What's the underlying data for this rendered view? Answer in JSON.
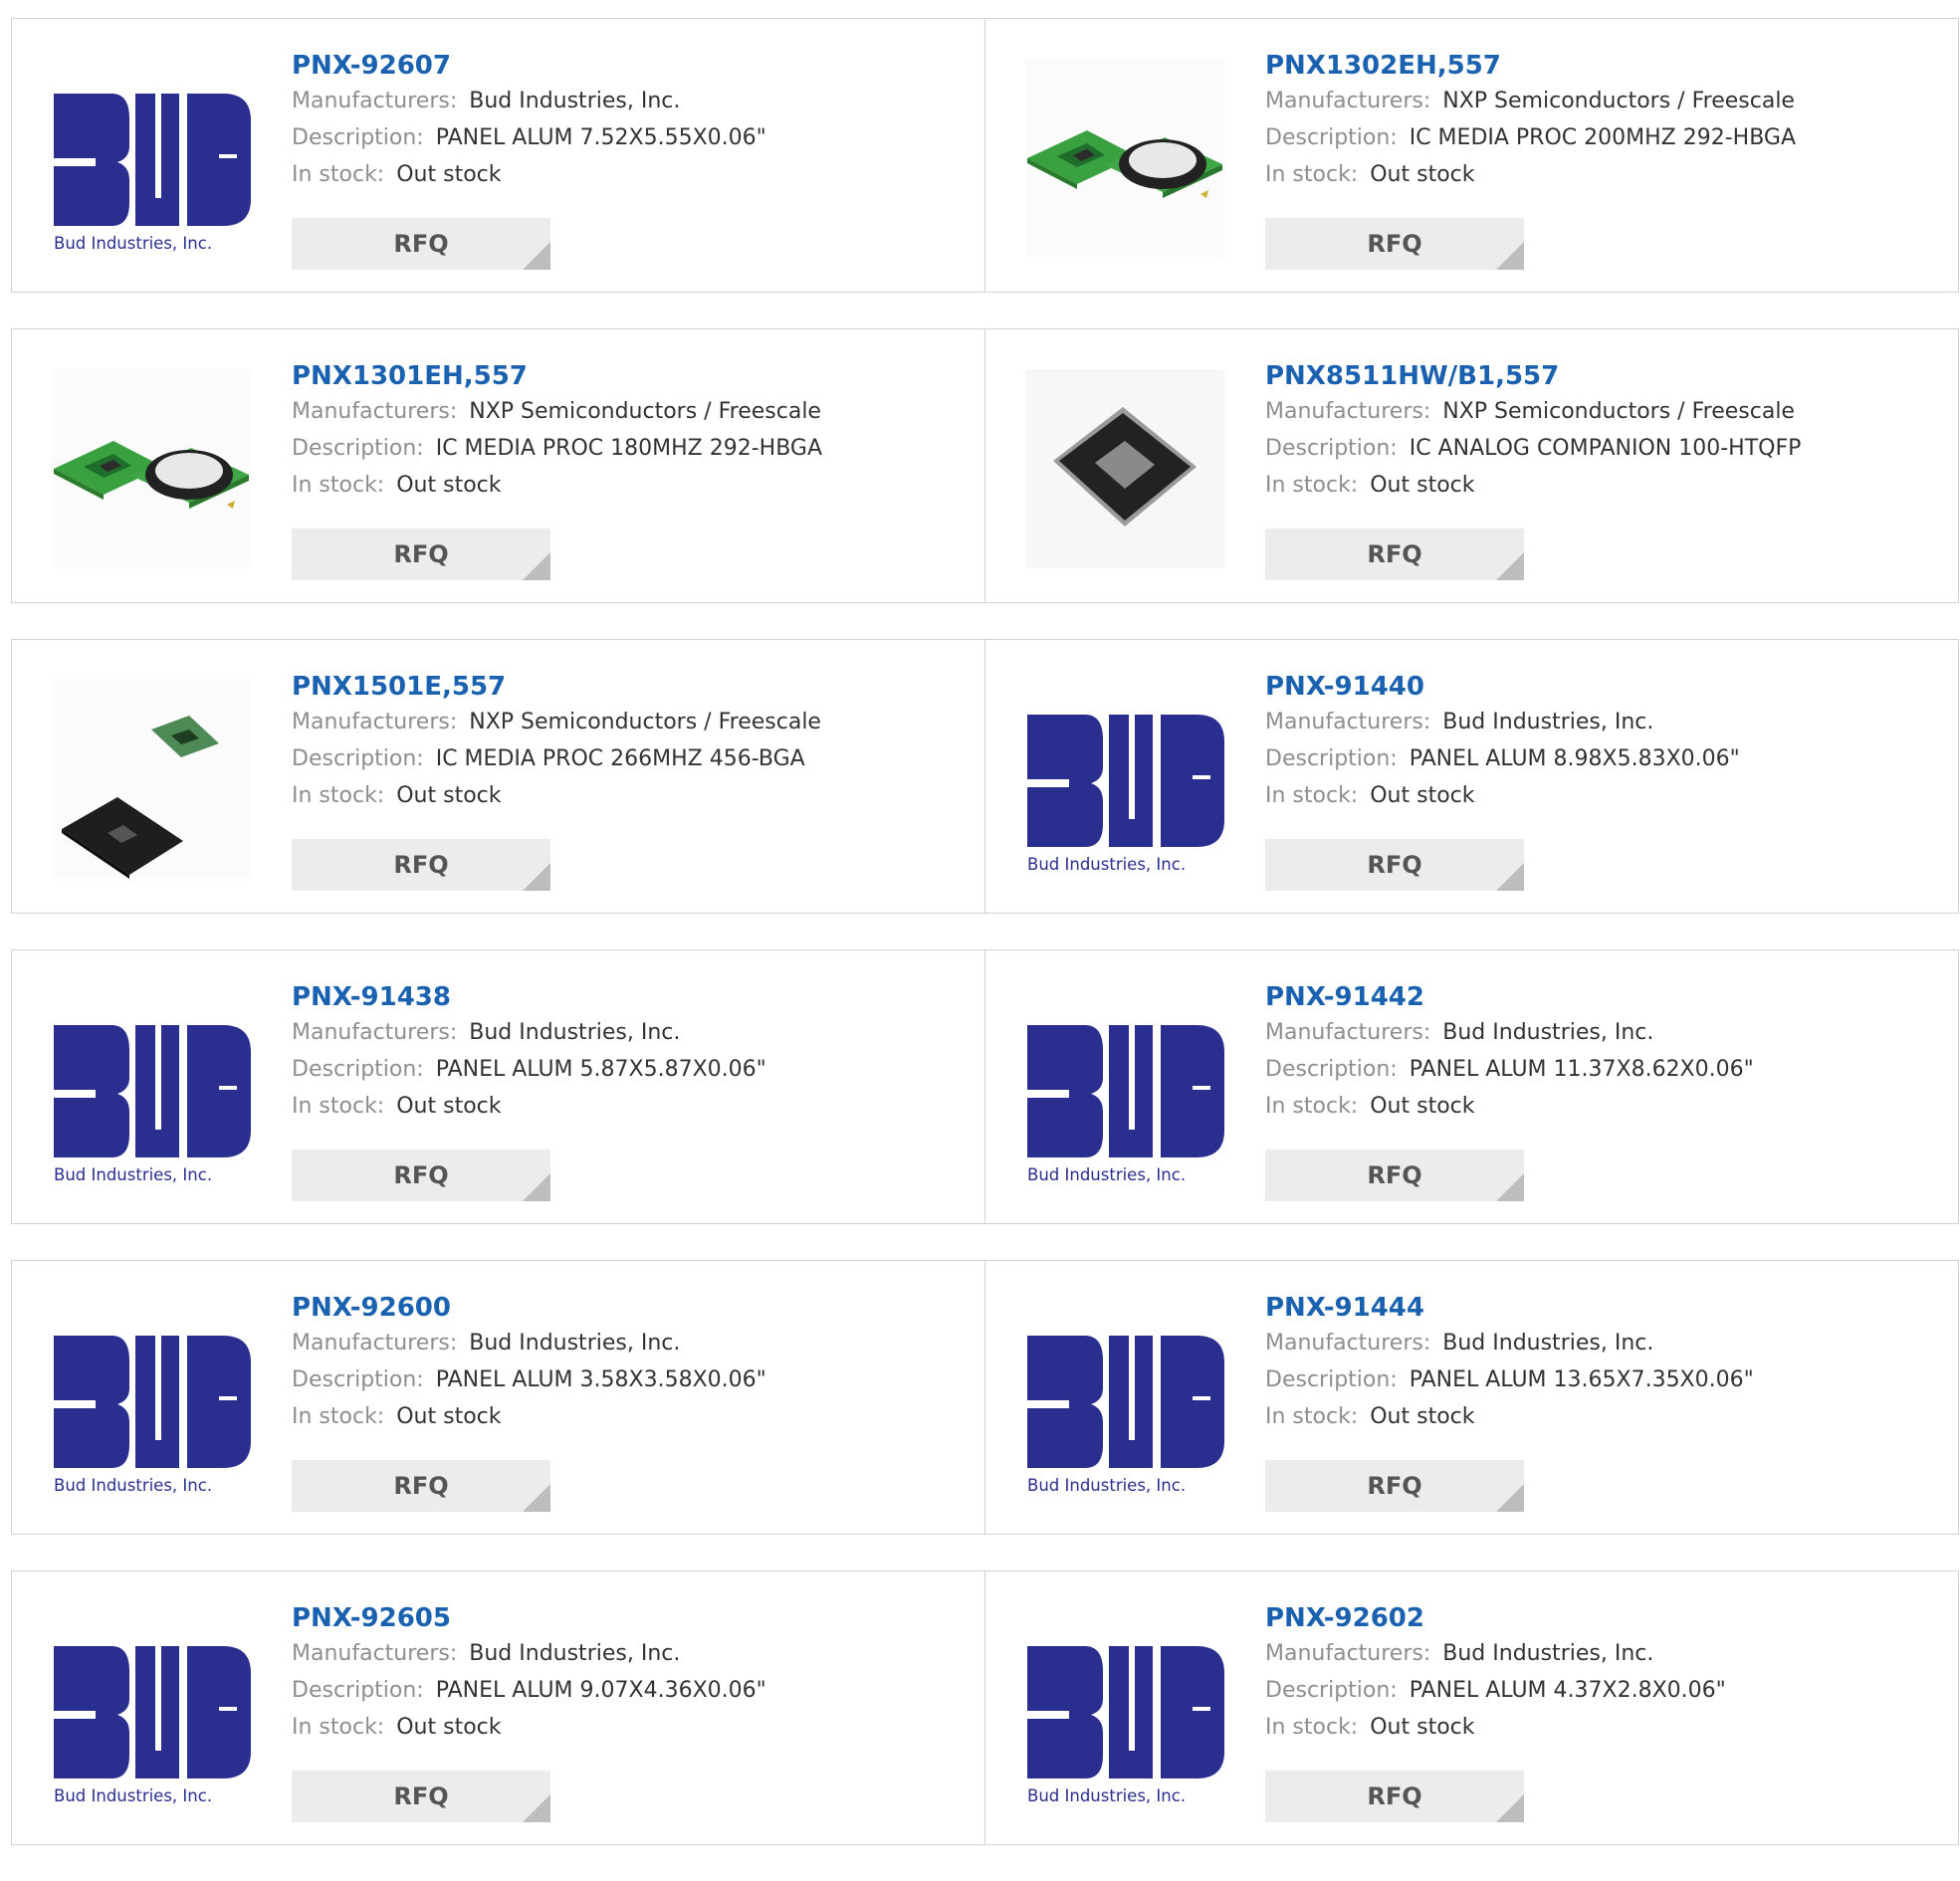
{
  "labels": {
    "manufacturers": "Manufacturers:",
    "description": "Description:",
    "in_stock": "In stock:",
    "rfq": "RFQ"
  },
  "logo": {
    "text": "Bud Industries, Inc.",
    "color": "#2a2f8f"
  },
  "accent_colors": {
    "title": "#1a62b0",
    "label": "#8e8e8e",
    "value": "#333333",
    "button_bg": "#ececec"
  },
  "products": [
    {
      "part": "PNX-92607",
      "manufacturer": "Bud Industries, Inc.",
      "description": "PANEL ALUM 7.52X5.55X0.06\"",
      "stock": "Out stock",
      "image": "bud-logo"
    },
    {
      "part": "PNX1302EH,557",
      "manufacturer": "NXP Semiconductors / Freescale",
      "description": "IC MEDIA PROC 200MHZ 292-HBGA",
      "stock": "Out stock",
      "image": "hbga-chip"
    },
    {
      "part": "PNX1301EH,557",
      "manufacturer": "NXP Semiconductors / Freescale",
      "description": "IC MEDIA PROC 180MHZ 292-HBGA",
      "stock": "Out stock",
      "image": "hbga-chip"
    },
    {
      "part": "PNX8511HW/B1,557",
      "manufacturer": "NXP Semiconductors / Freescale",
      "description": "IC ANALOG COMPANION 100-HTQFP",
      "stock": "Out stock",
      "image": "qfp-chip"
    },
    {
      "part": "PNX1501E,557",
      "manufacturer": "NXP Semiconductors / Freescale",
      "description": "IC MEDIA PROC 266MHZ 456-BGA",
      "stock": "Out stock",
      "image": "bga-chip"
    },
    {
      "part": "PNX-91440",
      "manufacturer": "Bud Industries, Inc.",
      "description": "PANEL ALUM 8.98X5.83X0.06\"",
      "stock": "Out stock",
      "image": "bud-logo"
    },
    {
      "part": "PNX-91438",
      "manufacturer": "Bud Industries, Inc.",
      "description": "PANEL ALUM 5.87X5.87X0.06\"",
      "stock": "Out stock",
      "image": "bud-logo"
    },
    {
      "part": "PNX-91442",
      "manufacturer": "Bud Industries, Inc.",
      "description": "PANEL ALUM 11.37X8.62X0.06\"",
      "stock": "Out stock",
      "image": "bud-logo"
    },
    {
      "part": "PNX-92600",
      "manufacturer": "Bud Industries, Inc.",
      "description": "PANEL ALUM 3.58X3.58X0.06\"",
      "stock": "Out stock",
      "image": "bud-logo"
    },
    {
      "part": "PNX-91444",
      "manufacturer": "Bud Industries, Inc.",
      "description": "PANEL ALUM 13.65X7.35X0.06\"",
      "stock": "Out stock",
      "image": "bud-logo"
    },
    {
      "part": "PNX-92605",
      "manufacturer": "Bud Industries, Inc.",
      "description": "PANEL ALUM 9.07X4.36X0.06\"",
      "stock": "Out stock",
      "image": "bud-logo"
    },
    {
      "part": "PNX-92602",
      "manufacturer": "Bud Industries, Inc.",
      "description": "PANEL ALUM 4.37X2.8X0.06\"",
      "stock": "Out stock",
      "image": "bud-logo"
    }
  ]
}
